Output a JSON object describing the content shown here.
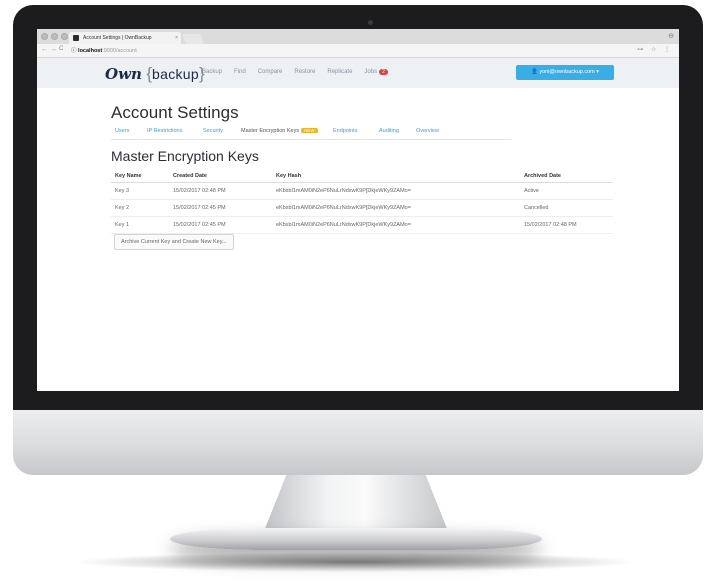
{
  "browser": {
    "tab_title": "Account Settings | OwnBackup",
    "tab_close": "×",
    "url_host": "localhost",
    "url_path": ":9000/account",
    "nav_back": "←",
    "nav_forward": "→",
    "nav_reload": "C",
    "url_info": "ⓘ",
    "addr_right": "⊶ ☆ ⋮",
    "profile": "⊖"
  },
  "header": {
    "logo_own": "Own",
    "logo_open": "{",
    "logo_backup": "backup",
    "logo_close": "}",
    "nav": [
      {
        "label": "Backup"
      },
      {
        "label": "Find"
      },
      {
        "label": "Compare"
      },
      {
        "label": "Restore"
      },
      {
        "label": "Replicate"
      },
      {
        "label": "Jobs",
        "badge": "2"
      }
    ],
    "user": "👤 yoni@ownbackup.com ▾"
  },
  "page": {
    "title": "Account Settings",
    "tabs": [
      {
        "label": "Users"
      },
      {
        "label": "IP Restrictions"
      },
      {
        "label": "Security"
      },
      {
        "label": "Master Encryption Keys",
        "badge": "NEW"
      },
      {
        "label": "Endpoints"
      },
      {
        "label": "Auditing"
      },
      {
        "label": "Overview"
      }
    ]
  },
  "keys": {
    "title": "Master Encryption Keys",
    "columns": [
      "Key Name",
      "Created Date",
      "Key Hash",
      "Archived Date"
    ],
    "rows": [
      [
        "Key 3",
        "15/02/2017 02:48 PM",
        "eKbsbl1mAM0iN2eP6NuLrNdxwK9P[DkjeWKy9ZAMo=",
        "Active"
      ],
      [
        "Key 2",
        "15/02/2017 02:45 PM",
        "eKbsbl1mAM0iN2eP6NuLrNdxwK9P[DkjeWKy9ZAMo=",
        "Cancelled"
      ],
      [
        "Key 1",
        "15/02/2017 02:45 PM",
        "eKbsbl1mAM0iN2eP6NuLrNdxwK9P[DkjeWKy9ZAMo=",
        "15/02/2017 02:48 PM"
      ]
    ],
    "archive_button": "Archive Current Key and Create New Key..."
  },
  "colors": {
    "accent": "#39aee6",
    "link": "#3ea0d8",
    "jobs_badge": "#e0403c",
    "new_badge": "#f0b429"
  }
}
